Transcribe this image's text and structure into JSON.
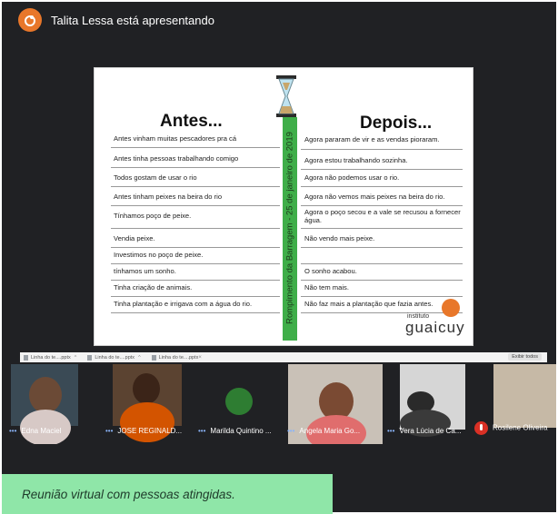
{
  "presenter": {
    "text": "Talita Lessa está apresentando",
    "avatar_color": "#e8772a"
  },
  "slide": {
    "left_title": "Antes...",
    "right_title": "Depois...",
    "vertical_text": "Rompimento da Barragem - 25 de janeiro de 2019",
    "before_items": [
      "Antes vinham muitas pescadores pra cá",
      "Antes tinha pessoas  trabalhando comigo",
      "Todos gostam de usar o rio",
      "Antes tinham peixes na beira do rio",
      "Tínhamos poço de peixe.",
      "Vendia peixe.",
      "Investimos no poço de peixe.",
      "tínhamos um sonho.",
      "Tinha criação de animais.",
      "Tinha plantação e irrigava com a água do rio."
    ],
    "after_items": [
      "Agora pararam de vir e as vendas pioraram.",
      "Agora estou trabalhando sozinha.",
      "Agora não podemos usar o rio.",
      "Agora não vemos mais peixes na beira do rio.",
      "Agora o poço secou e a vale se recusou a fornecer água.",
      "Não vendo mais peixe.",
      "",
      "O sonho acabou.",
      "Não tem mais.",
      "Não faz mais a plantação que fazia      antes."
    ],
    "logo_small": "instituto",
    "logo_big": "guaicuy",
    "accent_green": "#3fae49"
  },
  "tabs": {
    "items": [
      "Linha do te....pptx",
      "Linha do te....pptx",
      "Linha do te....pptx"
    ],
    "extra": "×",
    "right_button": "Exibir todos"
  },
  "participants": [
    {
      "name": "Edna Maciel",
      "muted": false
    },
    {
      "name": "JOSE REGINALD...",
      "muted": false
    },
    {
      "name": "Marilda Quintino ...",
      "muted": false
    },
    {
      "name": "Angela Maria Go...",
      "muted": false
    },
    {
      "name": "Vera Lúcia de Ca...",
      "muted": false
    },
    {
      "name": "Rosilene Oliveira",
      "muted": true
    }
  ],
  "caption": {
    "text": "Reunião virtual com pessoas atingidas.",
    "background": "#8fe6a8"
  }
}
